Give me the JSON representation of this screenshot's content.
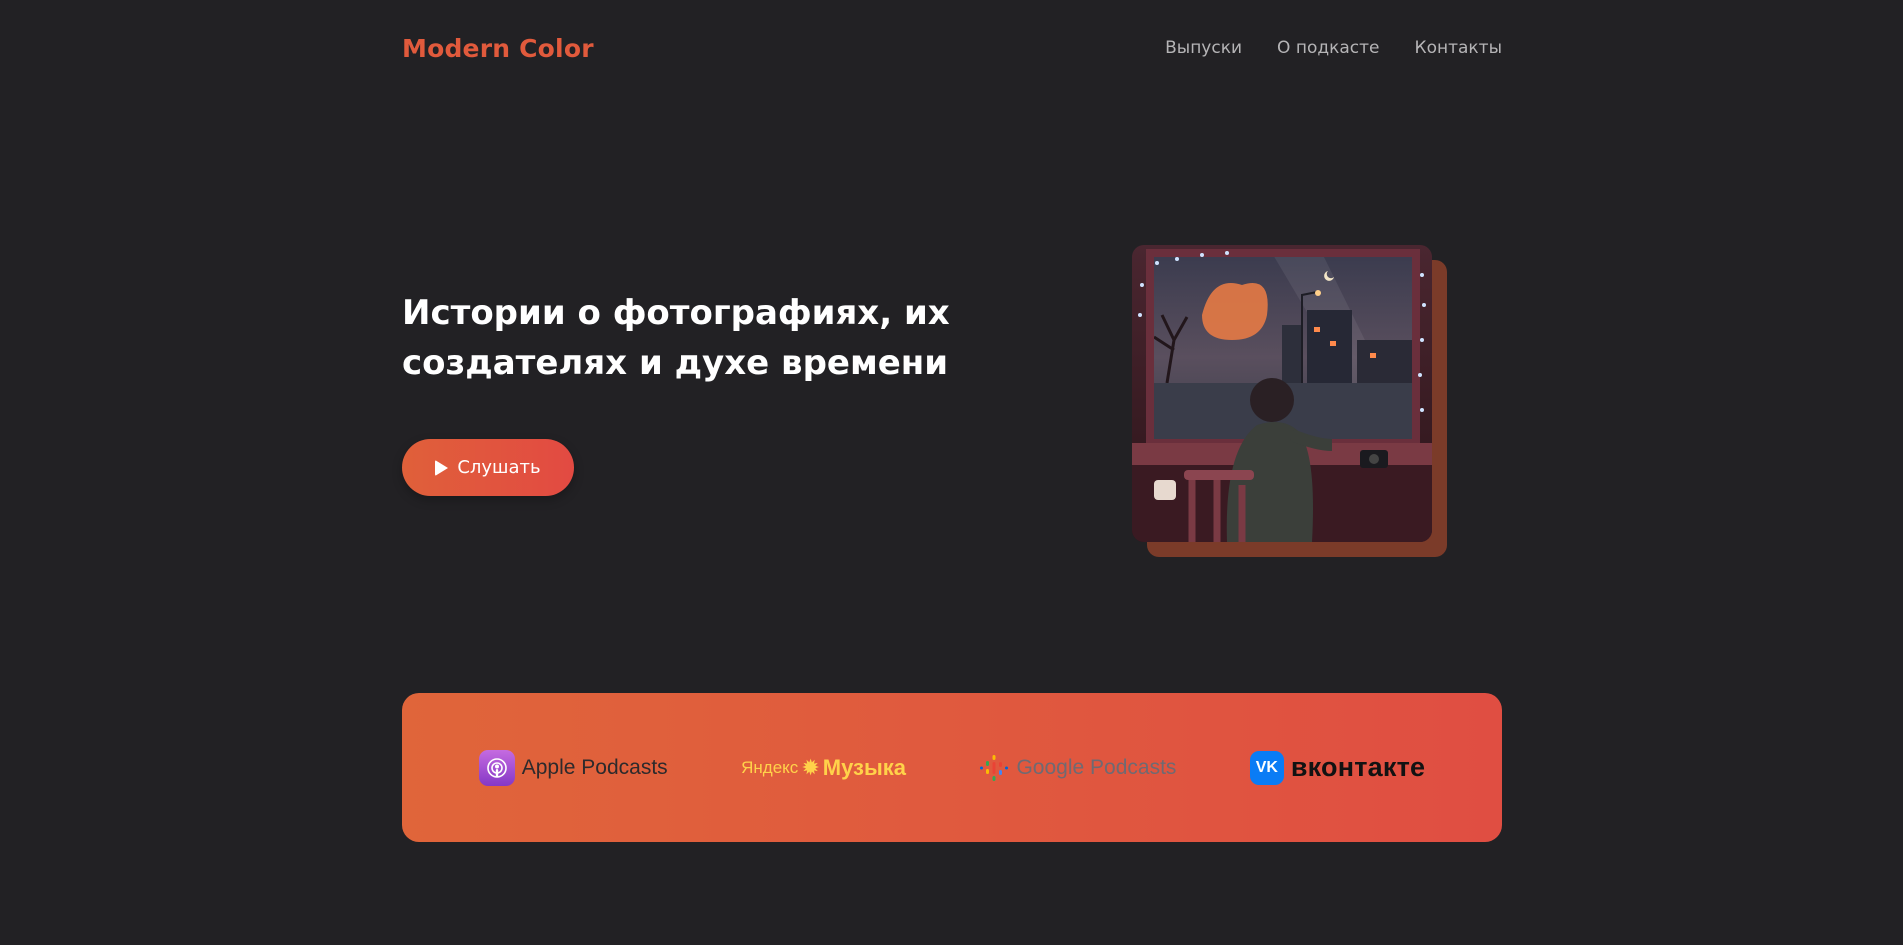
{
  "header": {
    "logo": "Modern Color",
    "nav": [
      {
        "label": "Выпуски"
      },
      {
        "label": "О подкасте"
      },
      {
        "label": "Контакты"
      }
    ]
  },
  "hero": {
    "title_line1": "Истории о фотографиях, их",
    "title_line2": "создателях и духе времени",
    "listen_button": "Слушать",
    "cover_alt": "Иллюстрация: человек у окна в вечернем городе"
  },
  "platforms": [
    {
      "name": "Apple Podcasts",
      "icon": "apple-podcasts-icon"
    },
    {
      "name_part1": "Яндекс",
      "name_part2": "Музыка",
      "icon": "sun-icon"
    },
    {
      "name": "Google Podcasts",
      "icon": "google-podcasts-icon"
    },
    {
      "name": "вконтакте",
      "icon_text": "VK",
      "icon": "vk-icon"
    }
  ],
  "colors": {
    "background": "#222124",
    "accent": "#e15a3c",
    "band_start": "#e0653a",
    "band_end": "#e04e42",
    "cover_shadow": "#7b3b29"
  }
}
